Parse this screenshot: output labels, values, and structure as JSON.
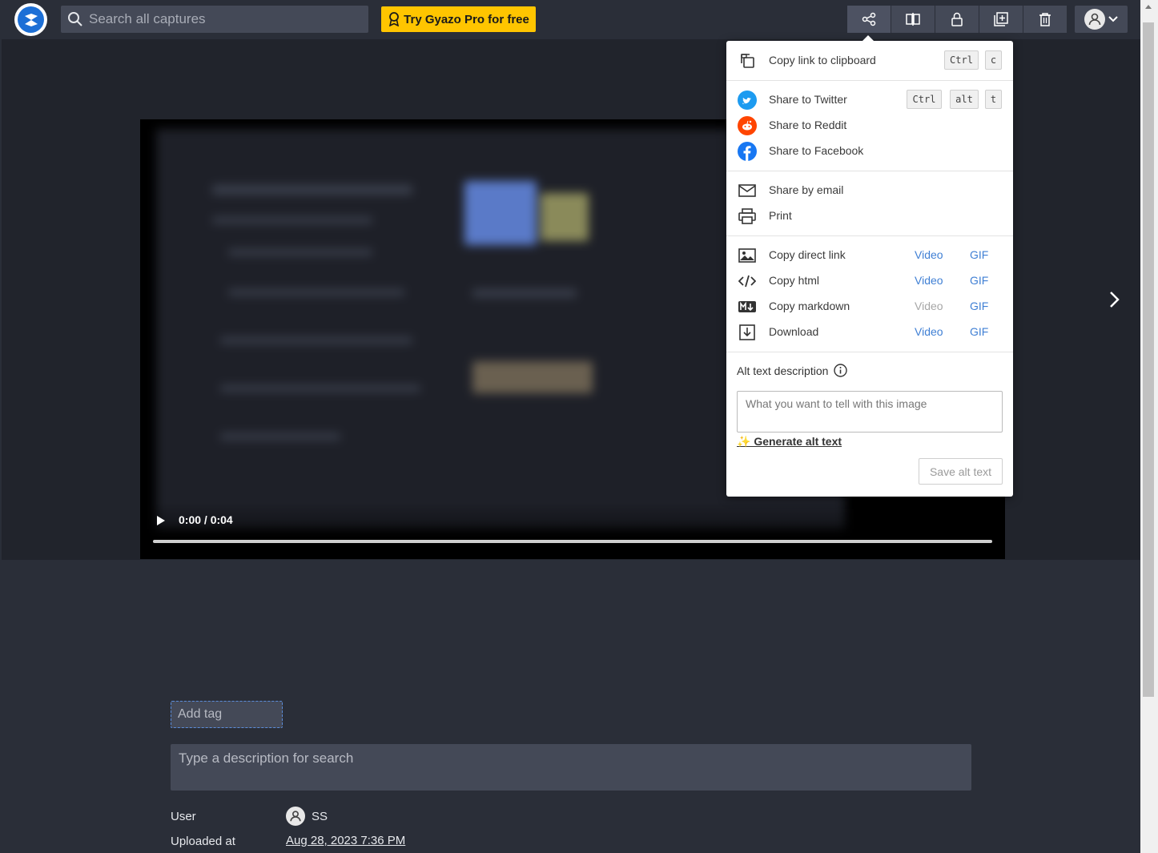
{
  "header": {
    "search_placeholder": "Search all captures",
    "pro_button": "Try Gyazo Pro for free",
    "toolbar_icons": [
      "share-icon",
      "compare-icon",
      "lock-icon",
      "add-to-collection-icon",
      "trash-icon"
    ]
  },
  "player": {
    "time": "0:00 / 0:04"
  },
  "share_menu": {
    "copy_link": {
      "label": "Copy link to clipboard",
      "keys": [
        "Ctrl",
        "c"
      ]
    },
    "twitter": {
      "label": "Share to Twitter",
      "keys": [
        "Ctrl",
        "alt",
        "t"
      ]
    },
    "reddit": {
      "label": "Share to Reddit"
    },
    "facebook": {
      "label": "Share to Facebook"
    },
    "email": {
      "label": "Share by email"
    },
    "print": {
      "label": "Print"
    },
    "direct_link": {
      "label": "Copy direct link",
      "video": "Video",
      "gif": "GIF"
    },
    "html": {
      "label": "Copy html",
      "video": "Video",
      "gif": "GIF"
    },
    "markdown": {
      "label": "Copy markdown",
      "video": "Video",
      "gif": "GIF"
    },
    "download": {
      "label": "Download",
      "video": "Video",
      "gif": "GIF"
    },
    "alt_text": {
      "label": "Alt text description",
      "placeholder": "What you want to tell with this image",
      "generate": "✨ Generate alt text",
      "save": "Save alt text"
    }
  },
  "details": {
    "add_tag": "Add tag",
    "description_placeholder": "Type a description for search",
    "user_label": "User",
    "user_name": "SS",
    "uploaded_label": "Uploaded at",
    "uploaded_value": "Aug 28, 2023 7:36 PM"
  },
  "colors": {
    "accent": "#ffc500",
    "link": "#3f7fd4",
    "twitter": "#1d9bf0",
    "reddit": "#ff4500",
    "facebook": "#1877f2"
  }
}
